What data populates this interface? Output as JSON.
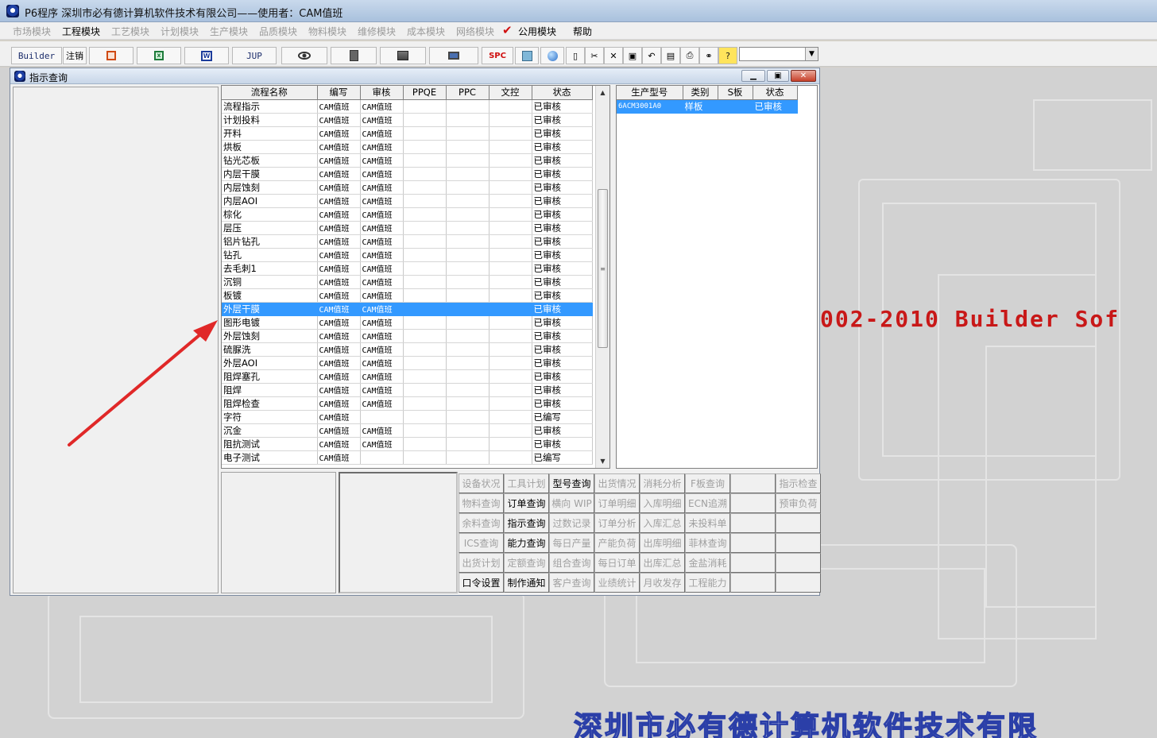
{
  "app": {
    "title": "P6程序    深圳市必有德计算机软件技术有限公司——使用者：CAM值班"
  },
  "menu": [
    {
      "label": "市场模块",
      "active": false
    },
    {
      "label": "工程模块",
      "active": true
    },
    {
      "label": "工艺模块",
      "active": false
    },
    {
      "label": "计划模块",
      "active": false
    },
    {
      "label": "生产模块",
      "active": false
    },
    {
      "label": "品质模块",
      "active": false
    },
    {
      "label": "物料模块",
      "active": false
    },
    {
      "label": "维修模块",
      "active": false
    },
    {
      "label": "成本模块",
      "active": false
    },
    {
      "label": "网络模块",
      "active": false
    },
    {
      "label": "公用模块",
      "active": true
    },
    {
      "label": "帮助",
      "active": true
    }
  ],
  "toolbar": {
    "builder": "Builder",
    "logout": "注销",
    "jup": "JUP",
    "spc": "SPC",
    "help": "?"
  },
  "window": {
    "title": "指示查询"
  },
  "main_grid": {
    "headers": [
      "流程名称",
      "编写",
      "审核",
      "PPQE",
      "PPC",
      "文控",
      "状态"
    ],
    "rows": [
      [
        "流程指示",
        "CAM值班",
        "CAM值班",
        "",
        "",
        "",
        "已审核"
      ],
      [
        "计划投料",
        "CAM值班",
        "CAM值班",
        "",
        "",
        "",
        "已审核"
      ],
      [
        "开料",
        "CAM值班",
        "CAM值班",
        "",
        "",
        "",
        "已审核"
      ],
      [
        "烘板",
        "CAM值班",
        "CAM值班",
        "",
        "",
        "",
        "已审核"
      ],
      [
        "钻光芯板",
        "CAM值班",
        "CAM值班",
        "",
        "",
        "",
        "已审核"
      ],
      [
        "内层干膜",
        "CAM值班",
        "CAM值班",
        "",
        "",
        "",
        "已审核"
      ],
      [
        "内层蚀刻",
        "CAM值班",
        "CAM值班",
        "",
        "",
        "",
        "已审核"
      ],
      [
        "内层AOI",
        "CAM值班",
        "CAM值班",
        "",
        "",
        "",
        "已审核"
      ],
      [
        "棕化",
        "CAM值班",
        "CAM值班",
        "",
        "",
        "",
        "已审核"
      ],
      [
        "层压",
        "CAM值班",
        "CAM值班",
        "",
        "",
        "",
        "已审核"
      ],
      [
        "铝片钻孔",
        "CAM值班",
        "CAM值班",
        "",
        "",
        "",
        "已审核"
      ],
      [
        "钻孔",
        "CAM值班",
        "CAM值班",
        "",
        "",
        "",
        "已审核"
      ],
      [
        "去毛刺1",
        "CAM值班",
        "CAM值班",
        "",
        "",
        "",
        "已审核"
      ],
      [
        "沉铜",
        "CAM值班",
        "CAM值班",
        "",
        "",
        "",
        "已审核"
      ],
      [
        "板镀",
        "CAM值班",
        "CAM值班",
        "",
        "",
        "",
        "已审核"
      ],
      [
        "外层干膜",
        "CAM值班",
        "CAM值班",
        "",
        "",
        "",
        "已审核"
      ],
      [
        "图形电镀",
        "CAM值班",
        "CAM值班",
        "",
        "",
        "",
        "已审核"
      ],
      [
        "外层蚀刻",
        "CAM值班",
        "CAM值班",
        "",
        "",
        "",
        "已审核"
      ],
      [
        "硫脲洗",
        "CAM值班",
        "CAM值班",
        "",
        "",
        "",
        "已审核"
      ],
      [
        "外层AOI",
        "CAM值班",
        "CAM值班",
        "",
        "",
        "",
        "已审核"
      ],
      [
        "阻焊塞孔",
        "CAM值班",
        "CAM值班",
        "",
        "",
        "",
        "已审核"
      ],
      [
        "阻焊",
        "CAM值班",
        "CAM值班",
        "",
        "",
        "",
        "已审核"
      ],
      [
        "阻焊检查",
        "CAM值班",
        "CAM值班",
        "",
        "",
        "",
        "已审核"
      ],
      [
        "字符",
        "CAM值班",
        "",
        "",
        "",
        "",
        "已编写"
      ],
      [
        "沉金",
        "CAM值班",
        "CAM值班",
        "",
        "",
        "",
        "已审核"
      ],
      [
        "阻抗测试",
        "CAM值班",
        "CAM值班",
        "",
        "",
        "",
        "已审核"
      ],
      [
        "电子测试",
        "CAM值班",
        "",
        "",
        "",
        "",
        "已编写"
      ]
    ],
    "selected_row": 15
  },
  "right_grid": {
    "headers": [
      "生产型号",
      "类别",
      "S板",
      "状态"
    ],
    "rows": [
      [
        "6ACM3001A0",
        "样板",
        "",
        "已审核"
      ]
    ]
  },
  "query_buttons": [
    {
      "label": "设备状况",
      "enabled": false
    },
    {
      "label": "工具计划",
      "enabled": false
    },
    {
      "label": "型号查询",
      "enabled": true
    },
    {
      "label": "出货情况",
      "enabled": false
    },
    {
      "label": "消耗分析",
      "enabled": false
    },
    {
      "label": "F板查询",
      "enabled": false
    },
    {
      "label": "",
      "enabled": false
    },
    {
      "label": "指示检查",
      "enabled": false
    },
    {
      "label": "物料查询",
      "enabled": false
    },
    {
      "label": "订单查询",
      "enabled": true
    },
    {
      "label": "横向 WIP",
      "enabled": false
    },
    {
      "label": "订单明细",
      "enabled": false
    },
    {
      "label": "入库明细",
      "enabled": false
    },
    {
      "label": "ECN追溯",
      "enabled": false
    },
    {
      "label": "",
      "enabled": false
    },
    {
      "label": "预审负荷",
      "enabled": false
    },
    {
      "label": "余料查询",
      "enabled": false
    },
    {
      "label": "指示查询",
      "enabled": true
    },
    {
      "label": "过数记录",
      "enabled": false
    },
    {
      "label": "订单分析",
      "enabled": false
    },
    {
      "label": "入库汇总",
      "enabled": false
    },
    {
      "label": "未投料单",
      "enabled": false
    },
    {
      "label": "",
      "enabled": false
    },
    {
      "label": "",
      "enabled": false
    },
    {
      "label": "ICS查询",
      "enabled": false
    },
    {
      "label": "能力查询",
      "enabled": true
    },
    {
      "label": "每日产量",
      "enabled": false
    },
    {
      "label": "产能负荷",
      "enabled": false
    },
    {
      "label": "出库明细",
      "enabled": false
    },
    {
      "label": "菲林查询",
      "enabled": false
    },
    {
      "label": "",
      "enabled": false
    },
    {
      "label": "",
      "enabled": false
    },
    {
      "label": "出货计划",
      "enabled": false
    },
    {
      "label": "定额查询",
      "enabled": false
    },
    {
      "label": "组合查询",
      "enabled": false
    },
    {
      "label": "每日订单",
      "enabled": false
    },
    {
      "label": "出库汇总",
      "enabled": false
    },
    {
      "label": "金盐消耗",
      "enabled": false
    },
    {
      "label": "",
      "enabled": false
    },
    {
      "label": "",
      "enabled": false
    },
    {
      "label": "口令设置",
      "enabled": true
    },
    {
      "label": "制作通知",
      "enabled": true
    },
    {
      "label": "客户查询",
      "enabled": false
    },
    {
      "label": "业绩统计",
      "enabled": false
    },
    {
      "label": "月收发存",
      "enabled": false
    },
    {
      "label": "工程能力",
      "enabled": false
    },
    {
      "label": "",
      "enabled": false
    },
    {
      "label": "",
      "enabled": false
    }
  ],
  "background": {
    "watermark": "002-2010 Builder Sof",
    "company": "深圳市必有德计算机软件技术有限"
  },
  "colors": {
    "selection": "#3399ff",
    "annotation_arrow": "#e02828",
    "watermark": "#c81818"
  }
}
